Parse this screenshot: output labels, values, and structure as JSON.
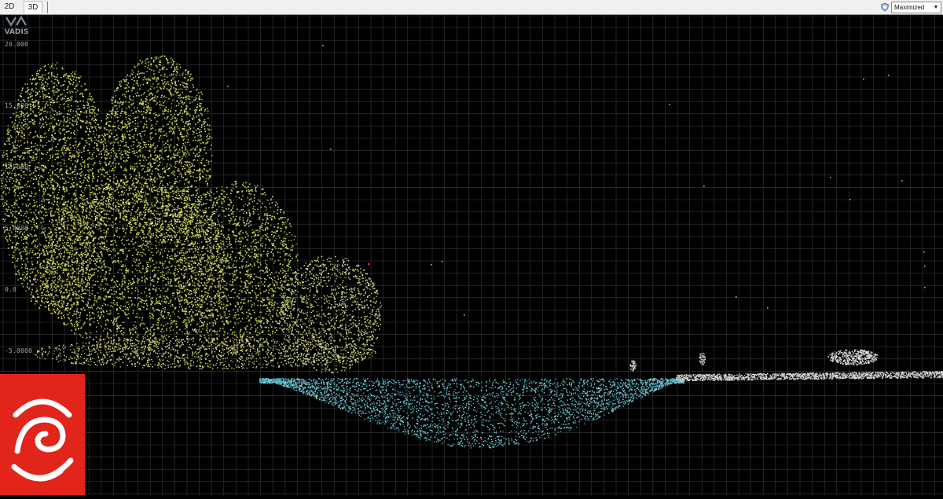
{
  "toolbar": {
    "tabs": [
      {
        "label": "2D",
        "active": false
      },
      {
        "label": "3D",
        "active": true
      }
    ],
    "view_mode": "Maximized"
  },
  "viewport": {
    "logo_text": "VADIS",
    "y_axis_labels": [
      "20.000",
      "15.000",
      "10.000",
      "5.0000",
      "0.0",
      "-5.0000"
    ],
    "background": "#000000",
    "grid_color": "#3a3a3a",
    "vegetation_color": "#b8c24a",
    "water_color": "#5fb8c4",
    "road_color": "#e6e6e6"
  },
  "overlay": {
    "brand_logo": "rnz-logo",
    "brand_color": "#e1251b"
  }
}
